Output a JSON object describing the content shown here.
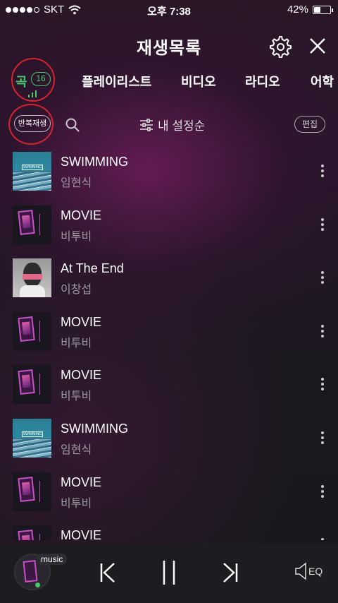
{
  "status_bar": {
    "carrier": "SKT",
    "time": "오후 7:38",
    "battery": "42%",
    "battery_level": 0.42
  },
  "header": {
    "title": "재생목록"
  },
  "tabs": [
    {
      "label": "곡",
      "count": "16",
      "active": true
    },
    {
      "label": "플레이리스트"
    },
    {
      "label": "비디오"
    },
    {
      "label": "라디오"
    },
    {
      "label": "어학"
    }
  ],
  "toolbar": {
    "repeat_label": "반복재생",
    "sort_label": "내 설정순",
    "edit_label": "편집"
  },
  "songs": [
    {
      "title": "SWIMMING",
      "artist": "임현식",
      "art": "swim"
    },
    {
      "title": "MOVIE",
      "artist": "비투비",
      "art": "movie"
    },
    {
      "title": "At The End",
      "artist": "이창섭",
      "art": "end"
    },
    {
      "title": "MOVIE",
      "artist": "비투비",
      "art": "movie"
    },
    {
      "title": "MOVIE",
      "artist": "비투비",
      "art": "movie"
    },
    {
      "title": "SWIMMING",
      "artist": "임현식",
      "art": "swim"
    },
    {
      "title": "MOVIE",
      "artist": "비투비",
      "art": "movie"
    },
    {
      "title": "MOVIE",
      "artist": "",
      "art": "movie"
    }
  ],
  "player": {
    "source_tag": "music",
    "eq_label": "EQ"
  },
  "colors": {
    "accent_green": "#45c96b",
    "highlight_red": "#d8232f"
  },
  "icons": [
    "wifi-icon",
    "gear-icon",
    "close-icon",
    "search-icon",
    "sort-icon",
    "more-icon",
    "previous-icon",
    "pause-icon",
    "next-icon",
    "speaker-icon"
  ]
}
